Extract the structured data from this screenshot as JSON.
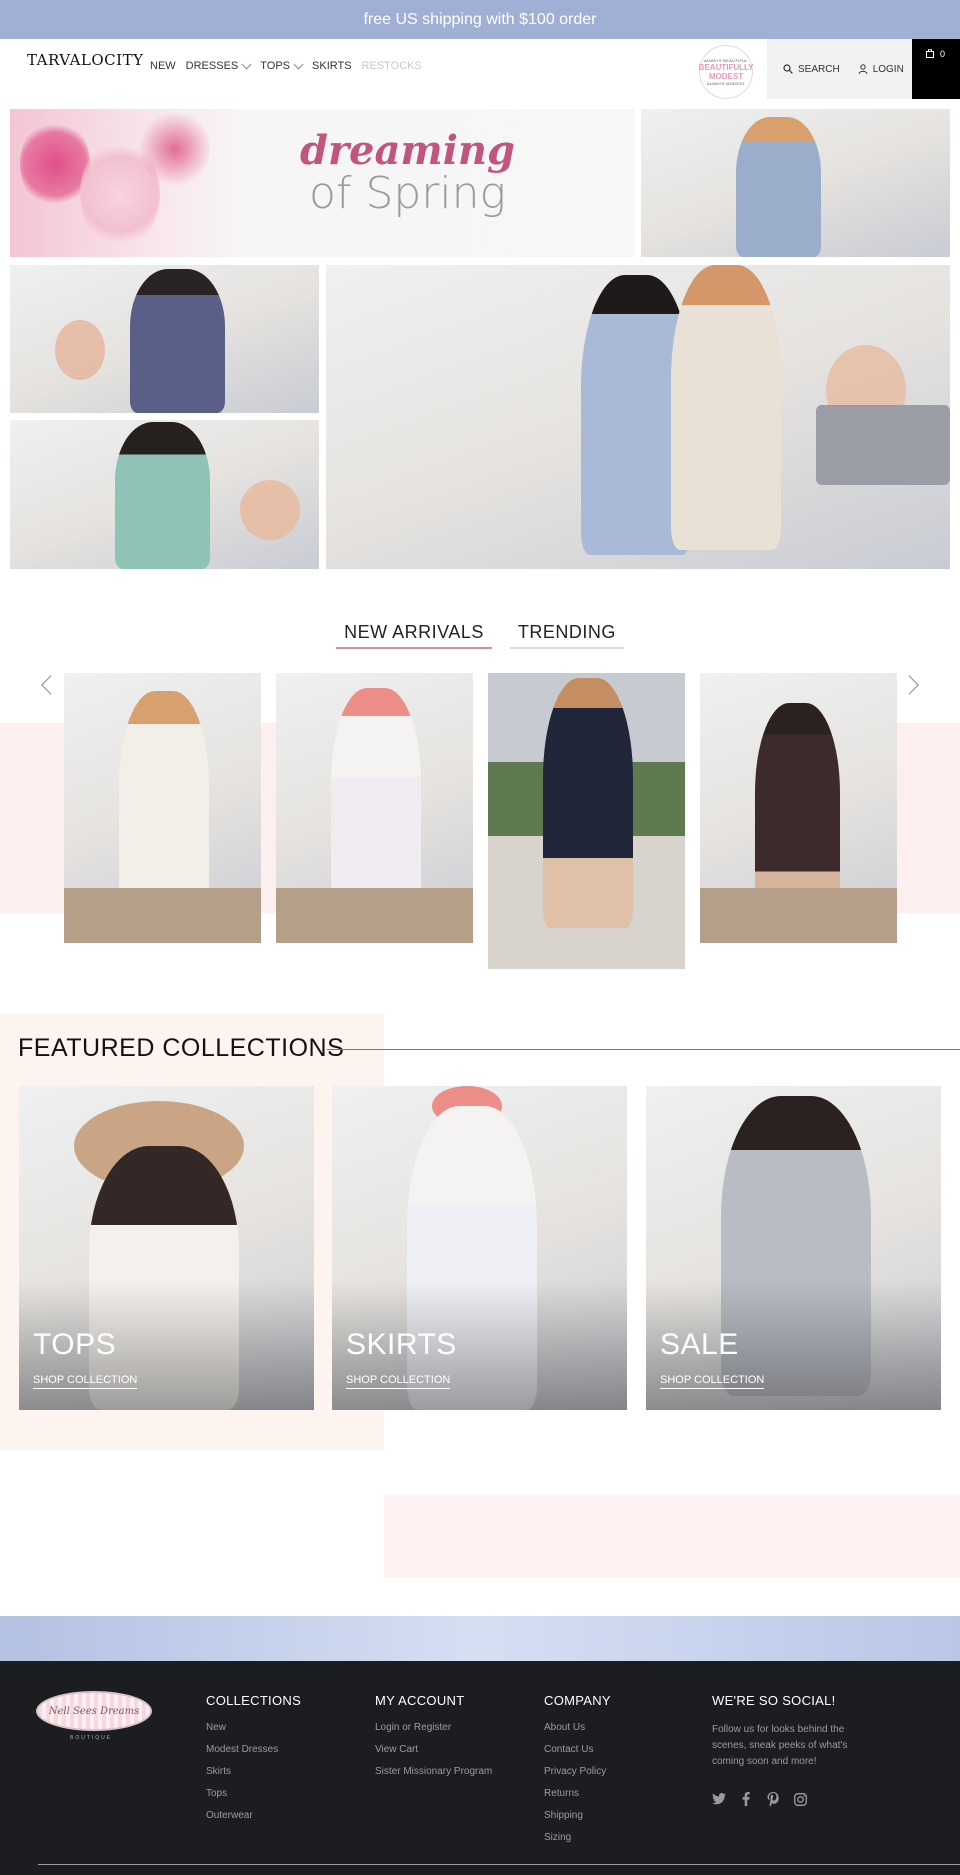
{
  "announcement": "free US shipping with $100 order",
  "header": {
    "logo": "TARVALOCITY",
    "nav": [
      {
        "label": "NEW",
        "dropdown": false
      },
      {
        "label": "DRESSES",
        "dropdown": true
      },
      {
        "label": "TOPS",
        "dropdown": true
      },
      {
        "label": "SKIRTS",
        "dropdown": false
      },
      {
        "label": "RESTOCKS",
        "dropdown": false
      }
    ],
    "badge": {
      "top": "ALWAYS BEAUTIFUL",
      "main": "BEAUTIFULLY MODEST",
      "bottom": "ALWAYS MODEST"
    },
    "search_label": "SEARCH",
    "login_label": "LOGIN",
    "cart_count": "0"
  },
  "hero": {
    "line1": "dreaming",
    "line2": "of Spring"
  },
  "tabs": [
    {
      "label": "NEW ARRIVALS",
      "active": true
    },
    {
      "label": "TRENDING",
      "active": false
    }
  ],
  "featured": {
    "title": "FEATURED COLLECTIONS",
    "collections": [
      {
        "title": "TOPS",
        "link": "SHOP COLLECTION"
      },
      {
        "title": "SKIRTS",
        "link": "SHOP COLLECTION"
      },
      {
        "title": "SALE",
        "link": "SHOP COLLECTION"
      }
    ]
  },
  "footer": {
    "logo": "Nell Sees Dreams",
    "logo_sub": "BOUTIQUE",
    "collections": {
      "heading": "COLLECTIONS",
      "links": [
        "New",
        "Modest Dresses",
        "Skirts",
        "Tops",
        "Outerwear"
      ]
    },
    "account": {
      "heading": "MY ACCOUNT",
      "links": [
        "Login or Register",
        "View Cart",
        "Sister Missionary Program"
      ]
    },
    "company": {
      "heading": "COMPANY",
      "links": [
        "About Us",
        "Contact Us",
        "Privacy Policy",
        "Returns",
        "Shipping",
        "Sizing"
      ]
    },
    "social": {
      "heading": "WE'RE SO SOCIAL!",
      "text": "Follow us for looks behind the scenes, sneak peeks of what's coming soon and more!",
      "icons": [
        "twitter-icon",
        "facebook-icon",
        "pinterest-icon",
        "instagram-icon"
      ]
    }
  },
  "colors": {
    "announce": "#9fb0d4",
    "accent_pink": "#d58ca2",
    "footer_bg": "#1c1d21"
  }
}
